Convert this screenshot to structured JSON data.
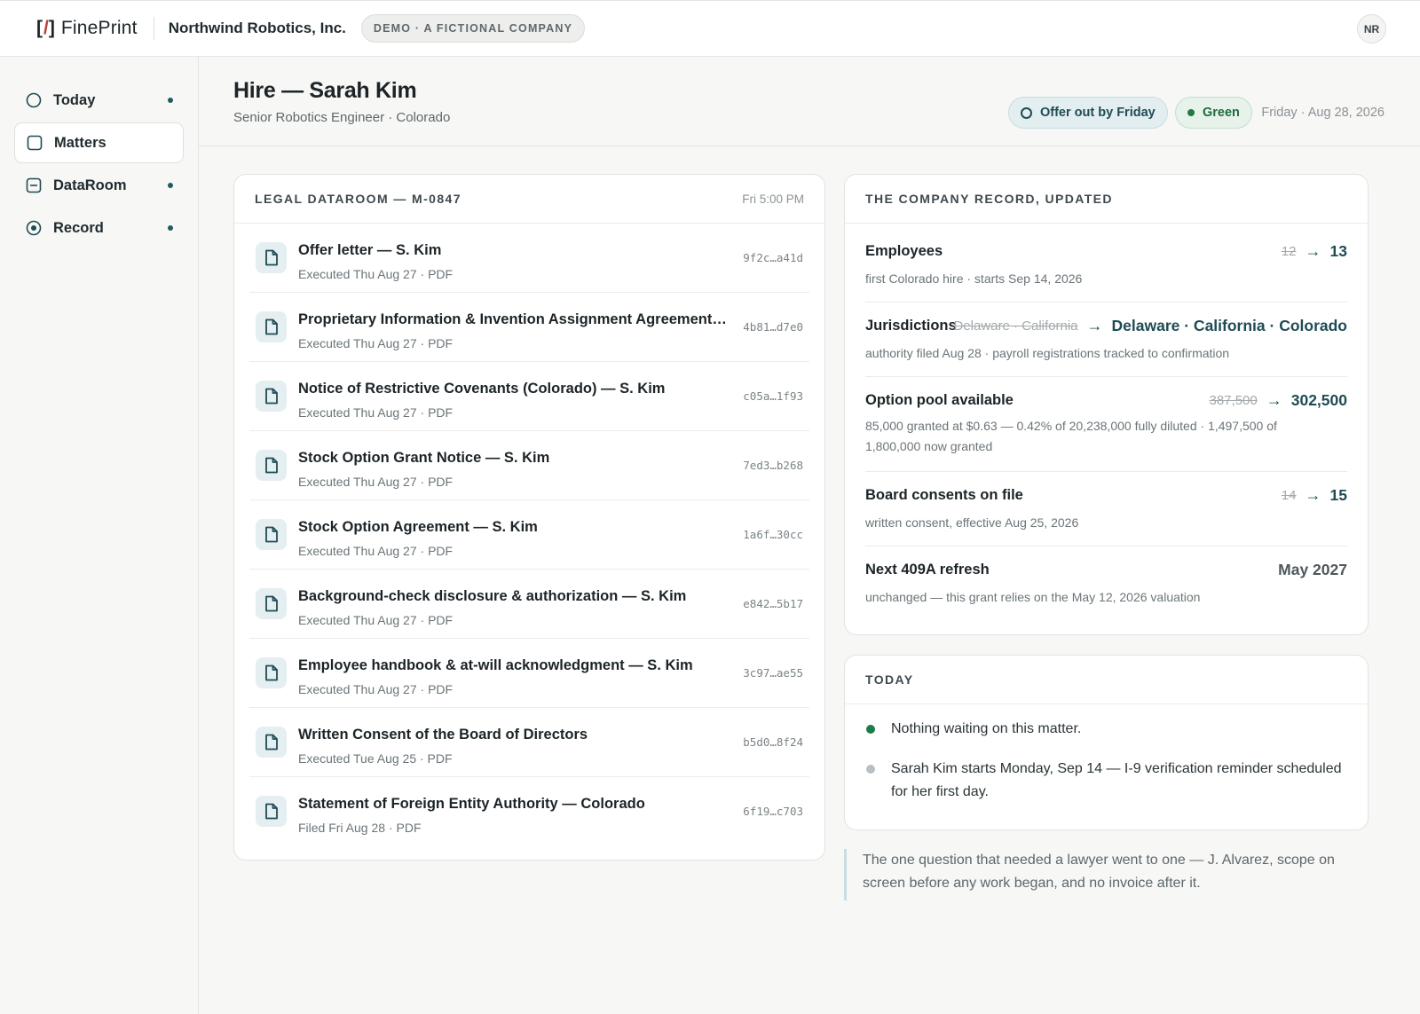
{
  "topbar": {
    "logo_bracket_open": "[",
    "logo_slash": "/",
    "logo_bracket_close": "]",
    "logo_word": "FinePrint",
    "company": "Northwind Robotics, Inc.",
    "badge": "DEMO · A FICTIONAL COMPANY",
    "avatar": "NR"
  },
  "sidebar": {
    "items": [
      {
        "label": "Today",
        "icon": "circle-icon",
        "dot": true,
        "active": false
      },
      {
        "label": "Matters",
        "icon": "square-icon",
        "dot": false,
        "active": true
      },
      {
        "label": "DataRoom",
        "icon": "folder-icon",
        "dot": true,
        "active": false
      },
      {
        "label": "Record",
        "icon": "target-icon",
        "dot": true,
        "active": false
      }
    ]
  },
  "header": {
    "title": "Hire — Sarah Kim",
    "subtitle": "Senior Robotics Engineer · Colorado",
    "deadline_pill": "Offer out by Friday",
    "status_pill": "Green",
    "date": "Friday · Aug 28, 2026"
  },
  "dataroom": {
    "label": "LEGAL DATAROOM — M-0847",
    "meta": "Fri 5:00 PM",
    "docs": [
      {
        "title": "Offer letter — S. Kim",
        "sub": "Executed Thu Aug 27 · PDF",
        "hash": "9f2c…a41d"
      },
      {
        "title": "Proprietary Information & Invention Assignment Agreement — S. Kim",
        "sub": "Executed Thu Aug 27 · PDF",
        "hash": "4b81…d7e0"
      },
      {
        "title": "Notice of Restrictive Covenants (Colorado) — S. Kim",
        "sub": "Executed Thu Aug 27 · PDF",
        "hash": "c05a…1f93"
      },
      {
        "title": "Stock Option Grant Notice — S. Kim",
        "sub": "Executed Thu Aug 27 · PDF",
        "hash": "7ed3…b268"
      },
      {
        "title": "Stock Option Agreement — S. Kim",
        "sub": "Executed Thu Aug 27 · PDF",
        "hash": "1a6f…30cc"
      },
      {
        "title": "Background-check disclosure & authorization — S. Kim",
        "sub": "Executed Thu Aug 27 · PDF",
        "hash": "e842…5b17"
      },
      {
        "title": "Employee handbook & at-will acknowledgment — S. Kim",
        "sub": "Executed Thu Aug 27 · PDF",
        "hash": "3c97…ae55"
      },
      {
        "title": "Written Consent of the Board of Directors",
        "sub": "Executed Tue Aug 25 · PDF",
        "hash": "b5d0…8f24"
      },
      {
        "title": "Statement of Foreign Entity Authority — Colorado",
        "sub": "Filed Fri Aug 28 · PDF",
        "hash": "6f19…c703"
      }
    ]
  },
  "record": {
    "label": "THE COMPANY RECORD, UPDATED",
    "rows": [
      {
        "name": "Employees",
        "old": "12",
        "new": "13",
        "sub": "first Colorado hire · starts Sep 14, 2026"
      },
      {
        "name": "Jurisdictions",
        "old": "Delaware · California",
        "new": "Delaware · California · Colorado",
        "sub": "authority filed Aug 28 · payroll registrations tracked to confirmation"
      },
      {
        "name": "Option pool available",
        "old": "387,500",
        "new": "302,500",
        "sub": "85,000 granted at $0.63 — 0.42% of 20,238,000 fully diluted · 1,497,500 of 1,800,000 now granted"
      },
      {
        "name": "Board consents on file",
        "old": "14",
        "new": "15",
        "sub": "written consent, effective Aug 25, 2026"
      },
      {
        "name": "Next 409A refresh",
        "value": "May 2027",
        "sub": "unchanged — this grant relies on the May 12, 2026 valuation"
      }
    ]
  },
  "today": {
    "label": "TODAY",
    "items": [
      {
        "text": "Nothing waiting on this matter.",
        "color": "#1f7a45"
      },
      {
        "text": "Sarah Kim starts Monday, Sep 14 — I-9 verification reminder scheduled for her first day.",
        "color": "#b9bfc2"
      }
    ]
  },
  "quote": "The one question that needed a lawyer went to one — J. Alvarez, scope on screen before any work began, and no invoice after it."
}
